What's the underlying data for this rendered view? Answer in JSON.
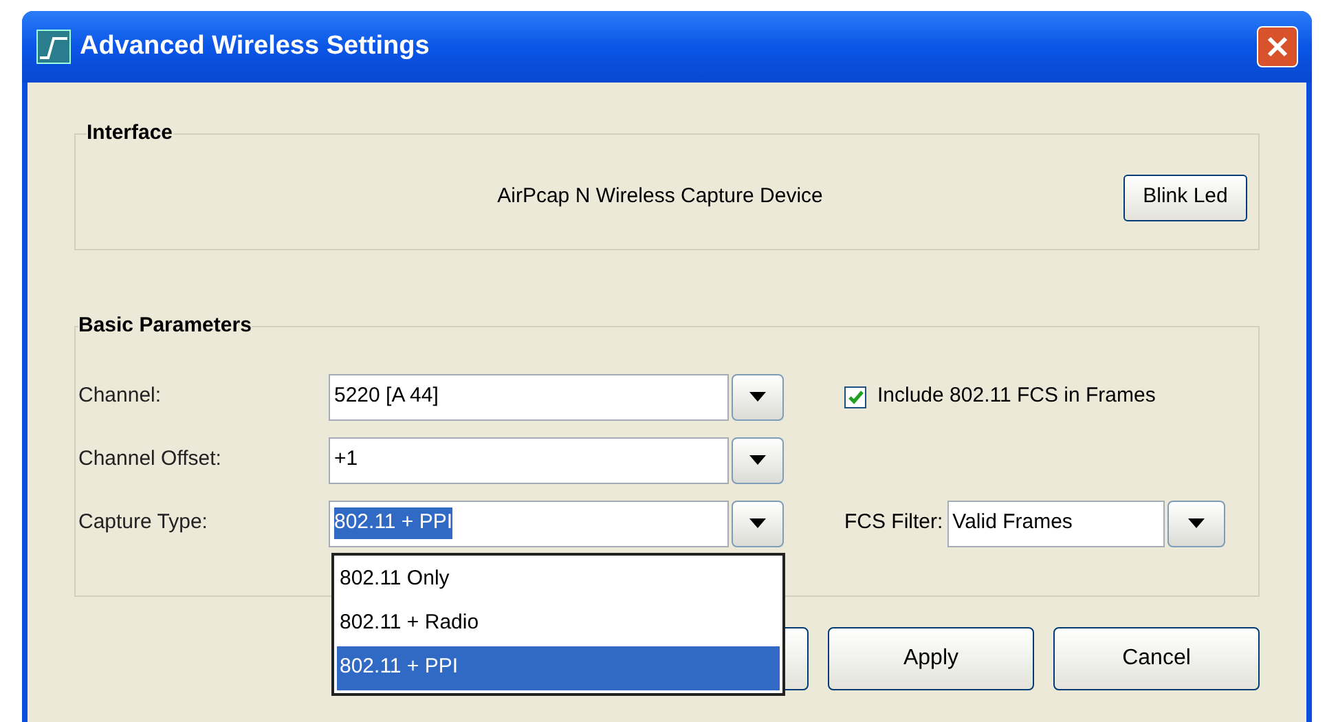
{
  "window": {
    "title": "Advanced Wireless Settings"
  },
  "interface": {
    "title": "Interface",
    "device": "AirPcap N Wireless Capture Device",
    "button": "Blink Led"
  },
  "basic_parameters": {
    "title": "Basic Parameters",
    "fields": [
      {
        "label": "Channel:",
        "value": "5220 [A 44]",
        "highlighted": false
      },
      {
        "label": "Channel Offset:",
        "value": "+1",
        "highlighted": false
      },
      {
        "label": "Capture Type:",
        "value": "802.11 + PPI",
        "highlighted": true,
        "options": [
          {
            "label": "802.11 Only",
            "selected": false
          },
          {
            "label": "802.11 + Radio",
            "selected": false
          },
          {
            "label": "802.11 + PPI",
            "selected": true
          }
        ]
      }
    ],
    "include_fcs": {
      "label": "Include 802.11 FCS in Frames",
      "checked": true
    },
    "fcs_filter": {
      "label": "FCS Filter:",
      "value": "Valid Frames"
    }
  },
  "buttons": [
    "Apply",
    "Cancel"
  ]
}
